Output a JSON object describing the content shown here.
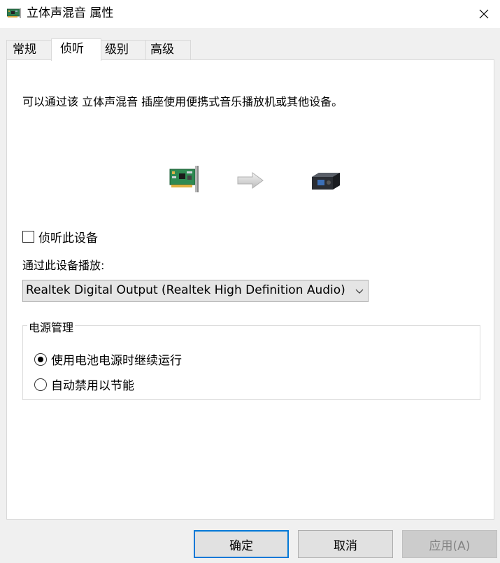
{
  "window": {
    "title": "立体声混音 属性",
    "title_icon": "sound-card-icon",
    "close_icon": "close-icon"
  },
  "tabs": [
    {
      "label": "常规",
      "active": false
    },
    {
      "label": "侦听",
      "active": true
    },
    {
      "label": "级别",
      "active": false
    },
    {
      "label": "高级",
      "active": false
    }
  ],
  "listen": {
    "description": "可以通过该 立体声混音 插座使用便携式音乐播放机或其他设备。",
    "diagram_icons": [
      "sound-card-icon",
      "arrow-right-icon",
      "speaker-output-icon"
    ],
    "listen_checkbox_label": "侦听此设备",
    "listen_checked": false,
    "playback_label": "通过此设备播放:",
    "playback_device": "Realtek Digital Output (Realtek High Definition Audio)",
    "power_group_title": "电源管理",
    "power_options": [
      {
        "label": "使用电池电源时继续运行",
        "selected": true
      },
      {
        "label": "自动禁用以节能",
        "selected": false
      }
    ]
  },
  "buttons": {
    "ok": "确定",
    "cancel": "取消",
    "apply": "应用(A)",
    "apply_enabled": false
  },
  "colors": {
    "focus_border": "#0078d7",
    "panel_bg": "#ffffff",
    "window_bg": "#f0f0f0"
  }
}
